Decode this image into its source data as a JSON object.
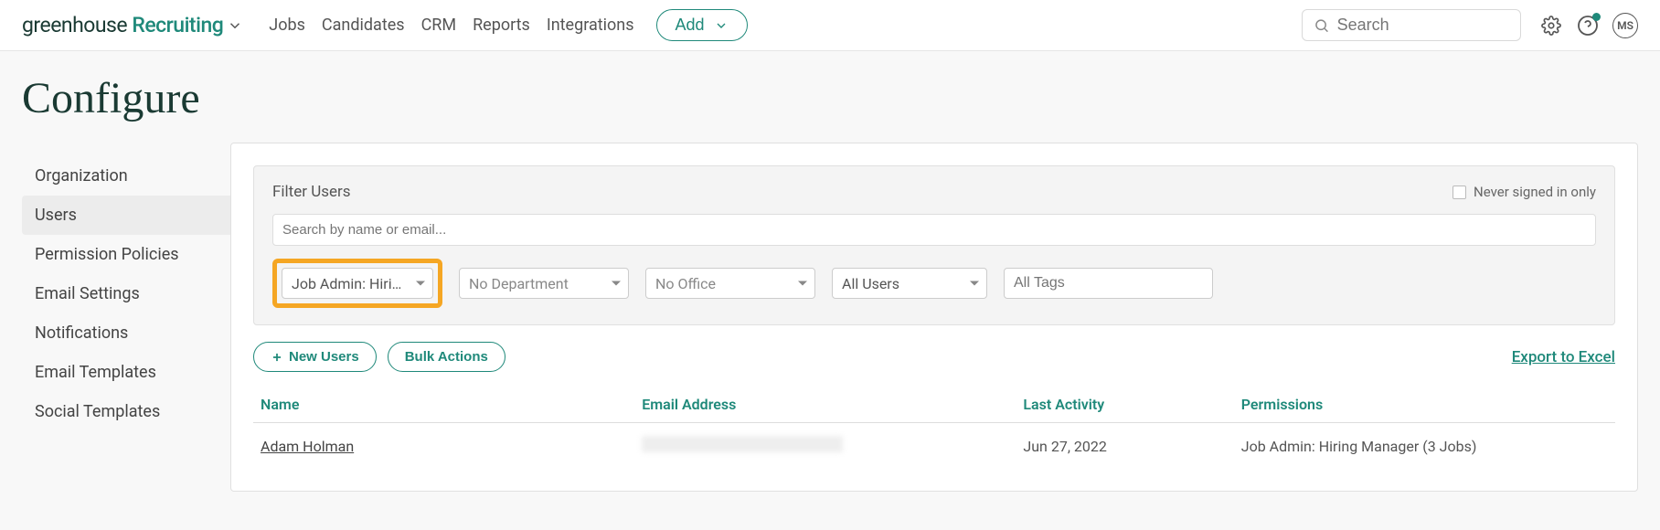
{
  "header": {
    "logo_dark": "greenhouse",
    "logo_green": "Recruiting",
    "nav": [
      "Jobs",
      "Candidates",
      "CRM",
      "Reports",
      "Integrations"
    ],
    "add_label": "Add",
    "search_placeholder": "Search",
    "avatar_initials": "MS"
  },
  "page": {
    "title": "Configure"
  },
  "sidebar": {
    "items": [
      {
        "label": "Organization",
        "active": false
      },
      {
        "label": "Users",
        "active": true
      },
      {
        "label": "Permission Policies",
        "active": false
      },
      {
        "label": "Email Settings",
        "active": false
      },
      {
        "label": "Notifications",
        "active": false
      },
      {
        "label": "Email Templates",
        "active": false
      },
      {
        "label": "Social Templates",
        "active": false
      }
    ]
  },
  "filters": {
    "title": "Filter Users",
    "never_signed_label": "Never signed in only",
    "search_placeholder": "Search by name or email...",
    "role_select": "Job Admin: Hiri…",
    "department_select": "No Department",
    "office_select": "No Office",
    "users_select": "All Users",
    "tags_placeholder": "All Tags"
  },
  "actions": {
    "new_users": "New Users",
    "bulk_actions": "Bulk Actions",
    "export": "Export to Excel"
  },
  "table": {
    "columns": [
      "Name",
      "Email Address",
      "Last Activity",
      "Permissions"
    ],
    "rows": [
      {
        "name": "Adam Holman",
        "email_redacted": true,
        "last_activity": "Jun 27, 2022",
        "permissions": "Job Admin: Hiring Manager (3 Jobs)"
      }
    ]
  }
}
